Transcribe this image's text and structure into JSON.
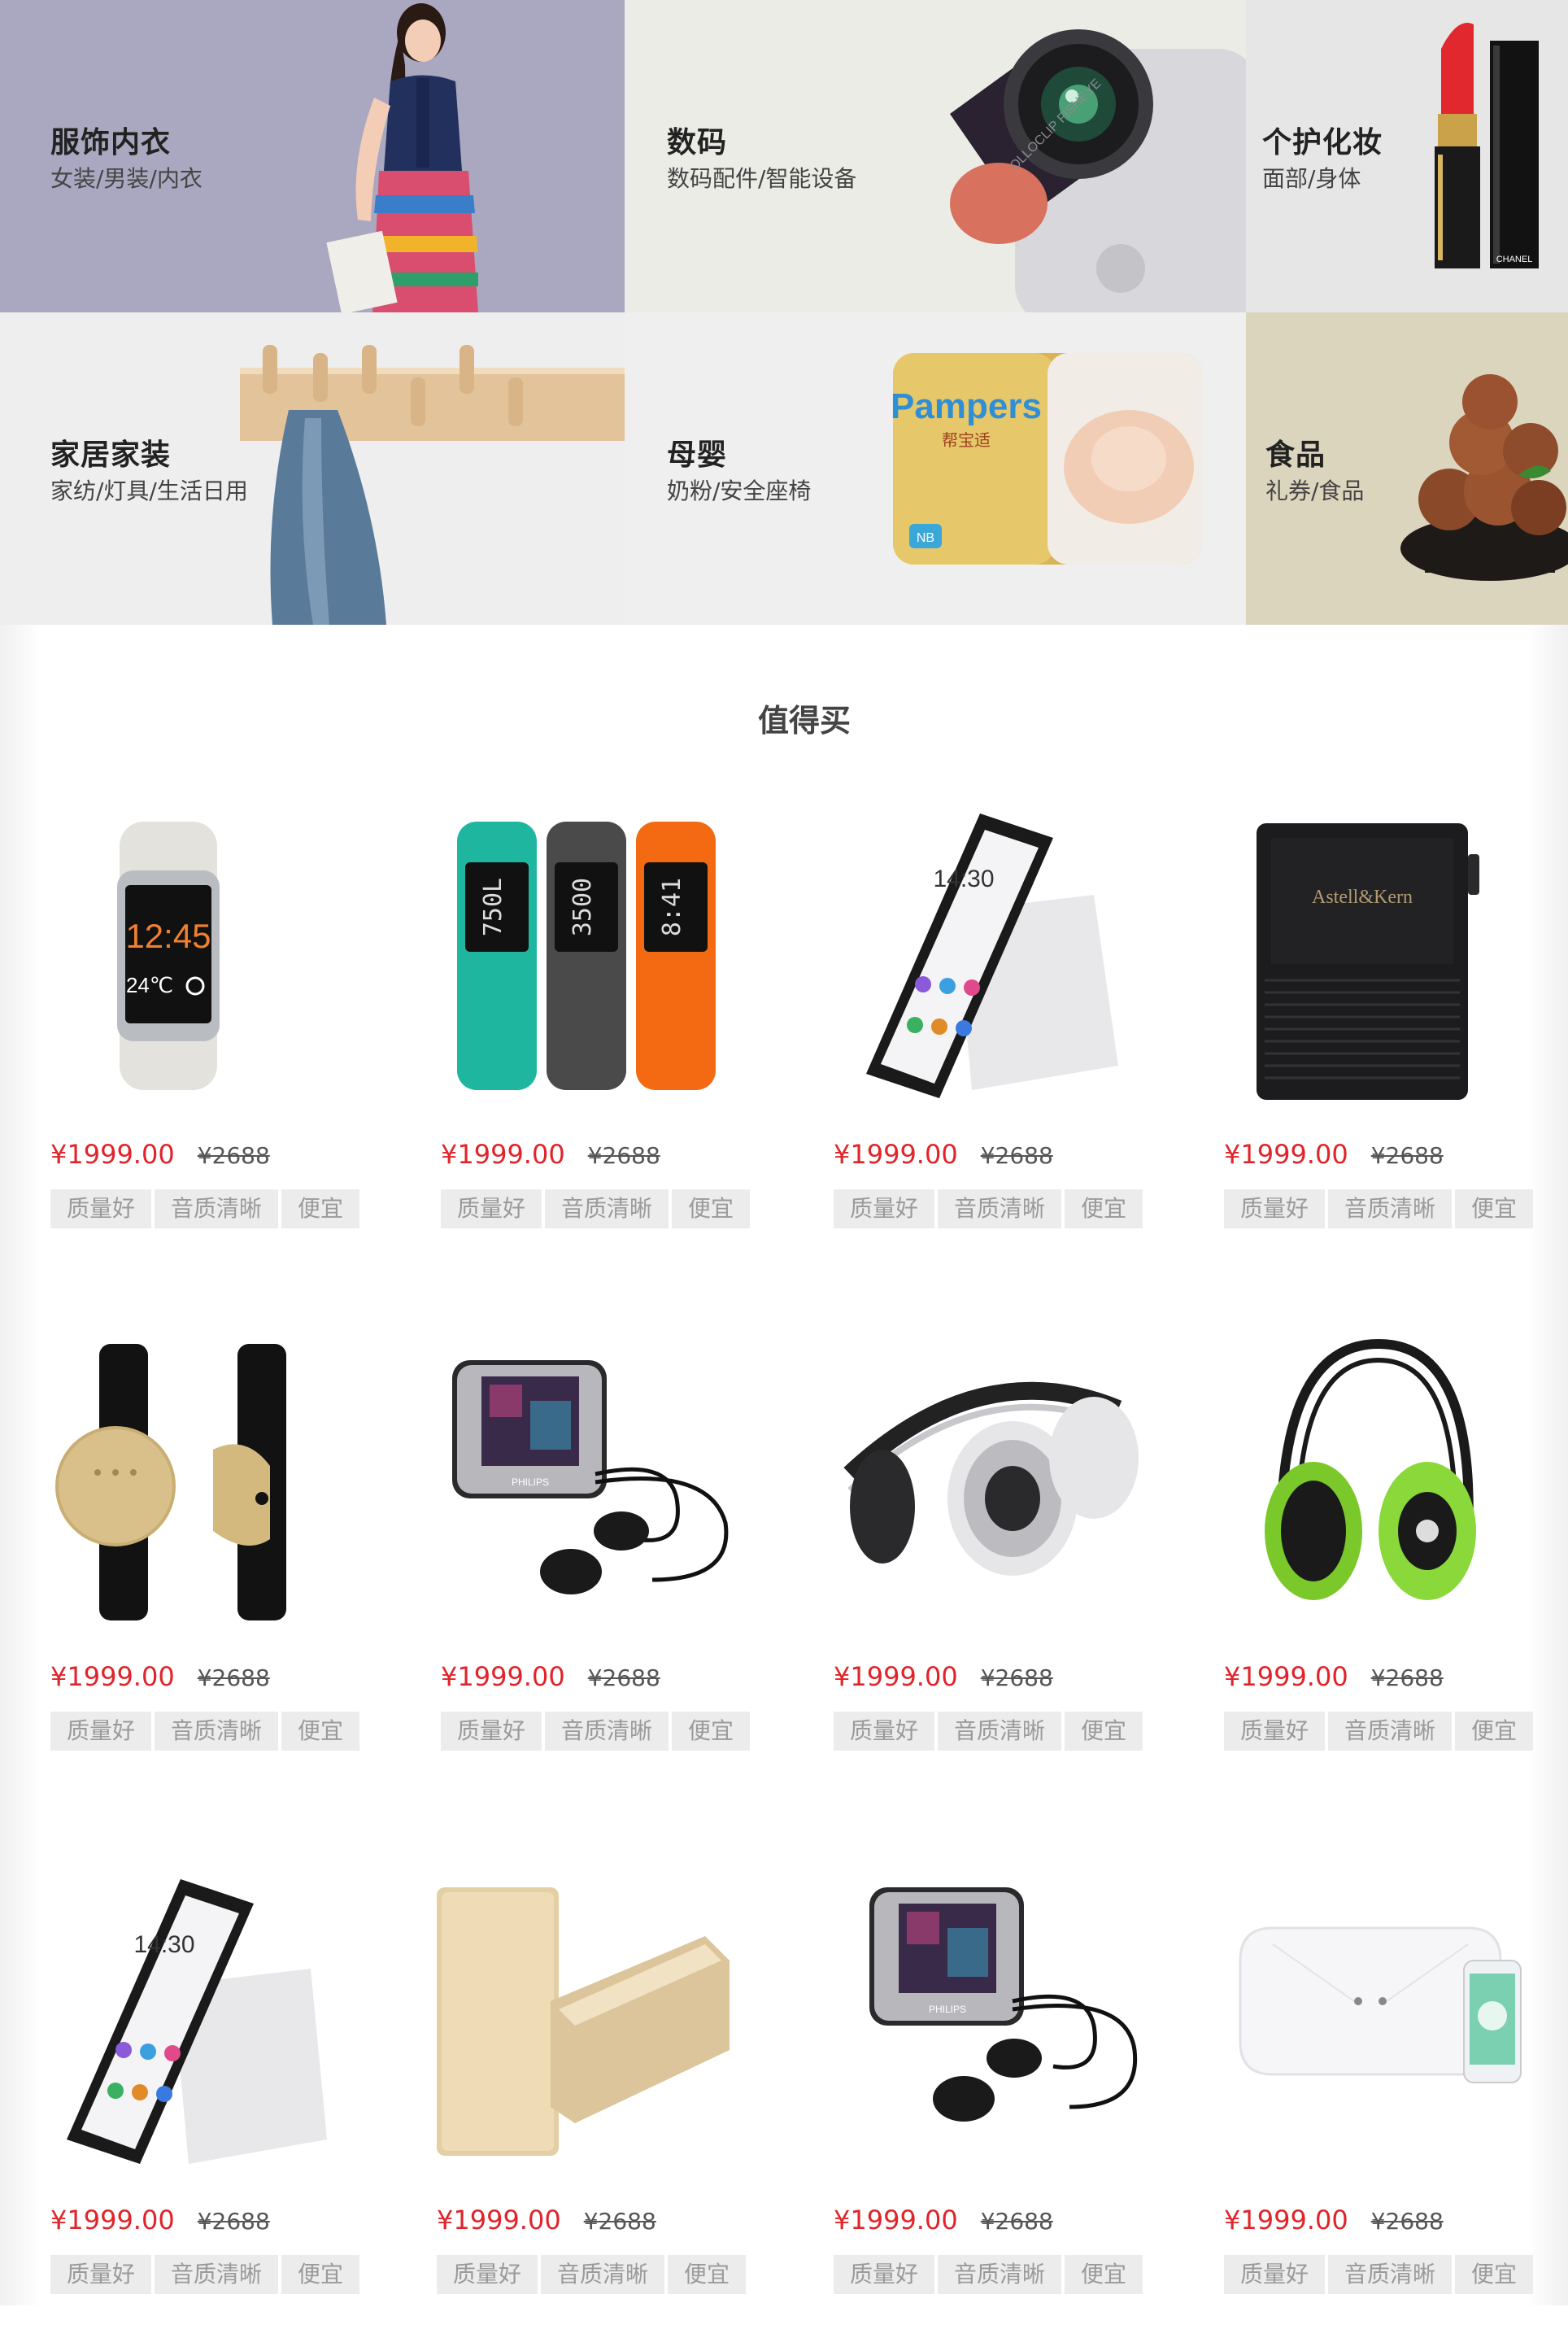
{
  "categories": [
    {
      "title": "服饰内衣",
      "sub": "女装/男装/内衣"
    },
    {
      "title": "数码",
      "sub": "数码配件/智能设备"
    },
    {
      "title": "个护化妆",
      "sub": "面部/身体"
    },
    {
      "title": "家居家装",
      "sub": "家纺/灯具/生活日用"
    },
    {
      "title": "母婴",
      "sub": "奶粉/安全座椅"
    },
    {
      "title": "食品",
      "sub": "礼券/食品"
    }
  ],
  "banner_texts": {
    "lens": "OLLOCLIP FISHEYE",
    "chanel": "CHANEL",
    "pampers": "Pampers",
    "pampers_cn": "帮宝适",
    "pampers_nb": "NB"
  },
  "section_title": "值得买",
  "products": [
    {
      "icon": "smartwatch-icon",
      "price": "¥1999.00",
      "old_price": "¥2688",
      "tags": [
        "质量好",
        "音质清晰",
        "便宜"
      ],
      "screen": {
        "time": "12:45",
        "temp": "24℃"
      }
    },
    {
      "icon": "fitness-band-icon",
      "price": "¥1999.00",
      "old_price": "¥2688",
      "tags": [
        "质量好",
        "音质清晰",
        "便宜"
      ],
      "screen": {
        "readouts": [
          "750L",
          "3500",
          "8:41"
        ]
      }
    },
    {
      "icon": "smartphone-icon",
      "price": "¥1999.00",
      "old_price": "¥2688",
      "tags": [
        "质量好",
        "音质清晰",
        "便宜"
      ],
      "screen": {
        "time": "14:30"
      }
    },
    {
      "icon": "music-player-icon",
      "price": "¥1999.00",
      "old_price": "¥2688",
      "tags": [
        "质量好",
        "音质清晰",
        "便宜"
      ],
      "screen": {
        "brand": "Astell&Kern"
      }
    },
    {
      "icon": "activity-tracker-icon",
      "price": "¥1999.00",
      "old_price": "¥2688",
      "tags": [
        "质量好",
        "音质清晰",
        "便宜"
      ]
    },
    {
      "icon": "mp3-player-earphones-icon",
      "price": "¥1999.00",
      "old_price": "¥2688",
      "tags": [
        "质量好",
        "音质清晰",
        "便宜"
      ],
      "screen": {
        "brand": "PHILIPS"
      }
    },
    {
      "icon": "headphones-icon",
      "price": "¥1999.00",
      "old_price": "¥2688",
      "tags": [
        "质量好",
        "音质清晰",
        "便宜"
      ]
    },
    {
      "icon": "green-headphones-icon",
      "price": "¥1999.00",
      "old_price": "¥2688",
      "tags": [
        "质量好",
        "音质清晰",
        "便宜"
      ]
    },
    {
      "icon": "smartphone-icon",
      "price": "¥1999.00",
      "old_price": "¥2688",
      "tags": [
        "质量好",
        "音质清晰",
        "便宜"
      ],
      "screen": {
        "time": "14:30"
      }
    },
    {
      "icon": "power-bank-icon",
      "price": "¥1999.00",
      "old_price": "¥2688",
      "tags": [
        "质量好",
        "音质清晰",
        "便宜"
      ]
    },
    {
      "icon": "mp3-player-earphones-icon",
      "price": "¥1999.00",
      "old_price": "¥2688",
      "tags": [
        "质量好",
        "音质清晰",
        "便宜"
      ],
      "screen": {
        "brand": "PHILIPS"
      }
    },
    {
      "icon": "smart-scale-icon",
      "price": "¥1999.00",
      "old_price": "¥2688",
      "tags": [
        "质量好",
        "音质清晰",
        "便宜"
      ]
    }
  ]
}
